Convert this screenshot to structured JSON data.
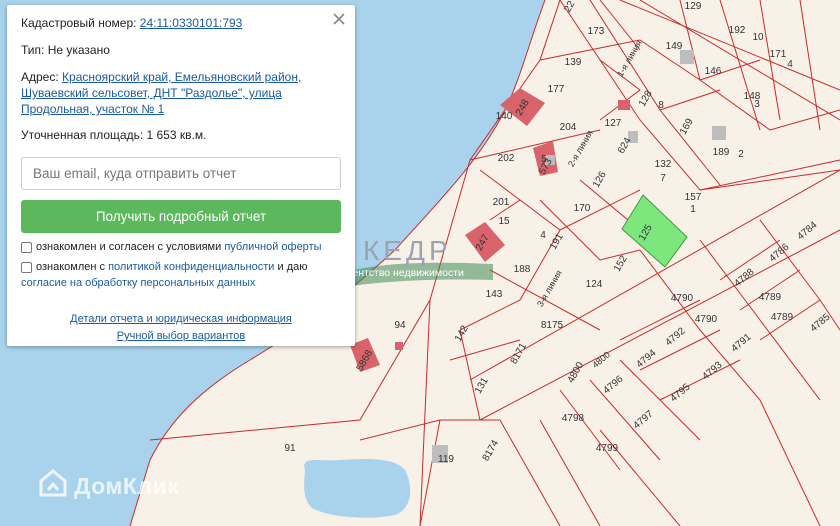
{
  "popup": {
    "cadastral_label": "Кадастровый номер:",
    "cadastral_value": "24:11:0330101:793",
    "type_label": "Тип:",
    "type_value": "Не указано",
    "address_label": "Адрес:",
    "address_line1": "Красноярский край, Емельяновский район,",
    "address_line2": "Шуваевский сельсовет, ДНТ \"Раздолье\", улица",
    "address_line3": "Продольная, участок № 1",
    "area_label": "Уточненная площадь:",
    "area_value": "1 653 кв.м.",
    "email_placeholder": "Ваш email, куда отправить отчет",
    "report_button": "Получить подробный отчет",
    "consent1_prefix": "ознакомлен и согласен с условиями",
    "consent1_link": "публичной оферты",
    "consent2_prefix": "ознакомлен с",
    "consent2_link1": "политикой конфиденциальности",
    "consent2_mid": "и даю",
    "consent2_link2": "согласие на обработку персональных данных",
    "details_link": "Детали отчета и юридическая информация",
    "manual_link": "Ручной выбор вариантов"
  },
  "watermarks": {
    "agency_name": "КЕДР",
    "agency_subtitle": "агентство недвижимости",
    "site_name": "ДомКлик"
  },
  "map": {
    "colors": {
      "water": "#a9d3ec",
      "land": "#f7f1e8",
      "boundary": "#cc2a2a",
      "highlight": "#7de67d",
      "building": "#d9636b"
    },
    "plot_labels": [
      "129",
      "173",
      "22",
      "192",
      "10",
      "171",
      "4",
      "149",
      "146",
      "139",
      "177",
      "148",
      "3",
      "128",
      "8",
      "127",
      "169",
      "140",
      "248",
      "204",
      "624",
      "189",
      "2",
      "5",
      "573",
      "132",
      "7",
      "202",
      "126",
      "157",
      "1",
      "201",
      "170",
      "125",
      "191",
      "4",
      "15",
      "247",
      "188",
      "152",
      "124",
      "143",
      "8175",
      "142",
      "8171",
      "4800",
      "4784",
      "4786",
      "4788",
      "4789",
      "4790",
      "4785",
      "4789",
      "4790",
      "4791",
      "4792",
      "4793",
      "4794",
      "4795",
      "4796",
      "4797",
      "4798",
      "4799",
      "131",
      "5868",
      "94",
      "91",
      "119",
      "8174"
    ],
    "street_labels": [
      "1-я линия",
      "2-я линия",
      "3-я линия",
      "4800"
    ]
  }
}
